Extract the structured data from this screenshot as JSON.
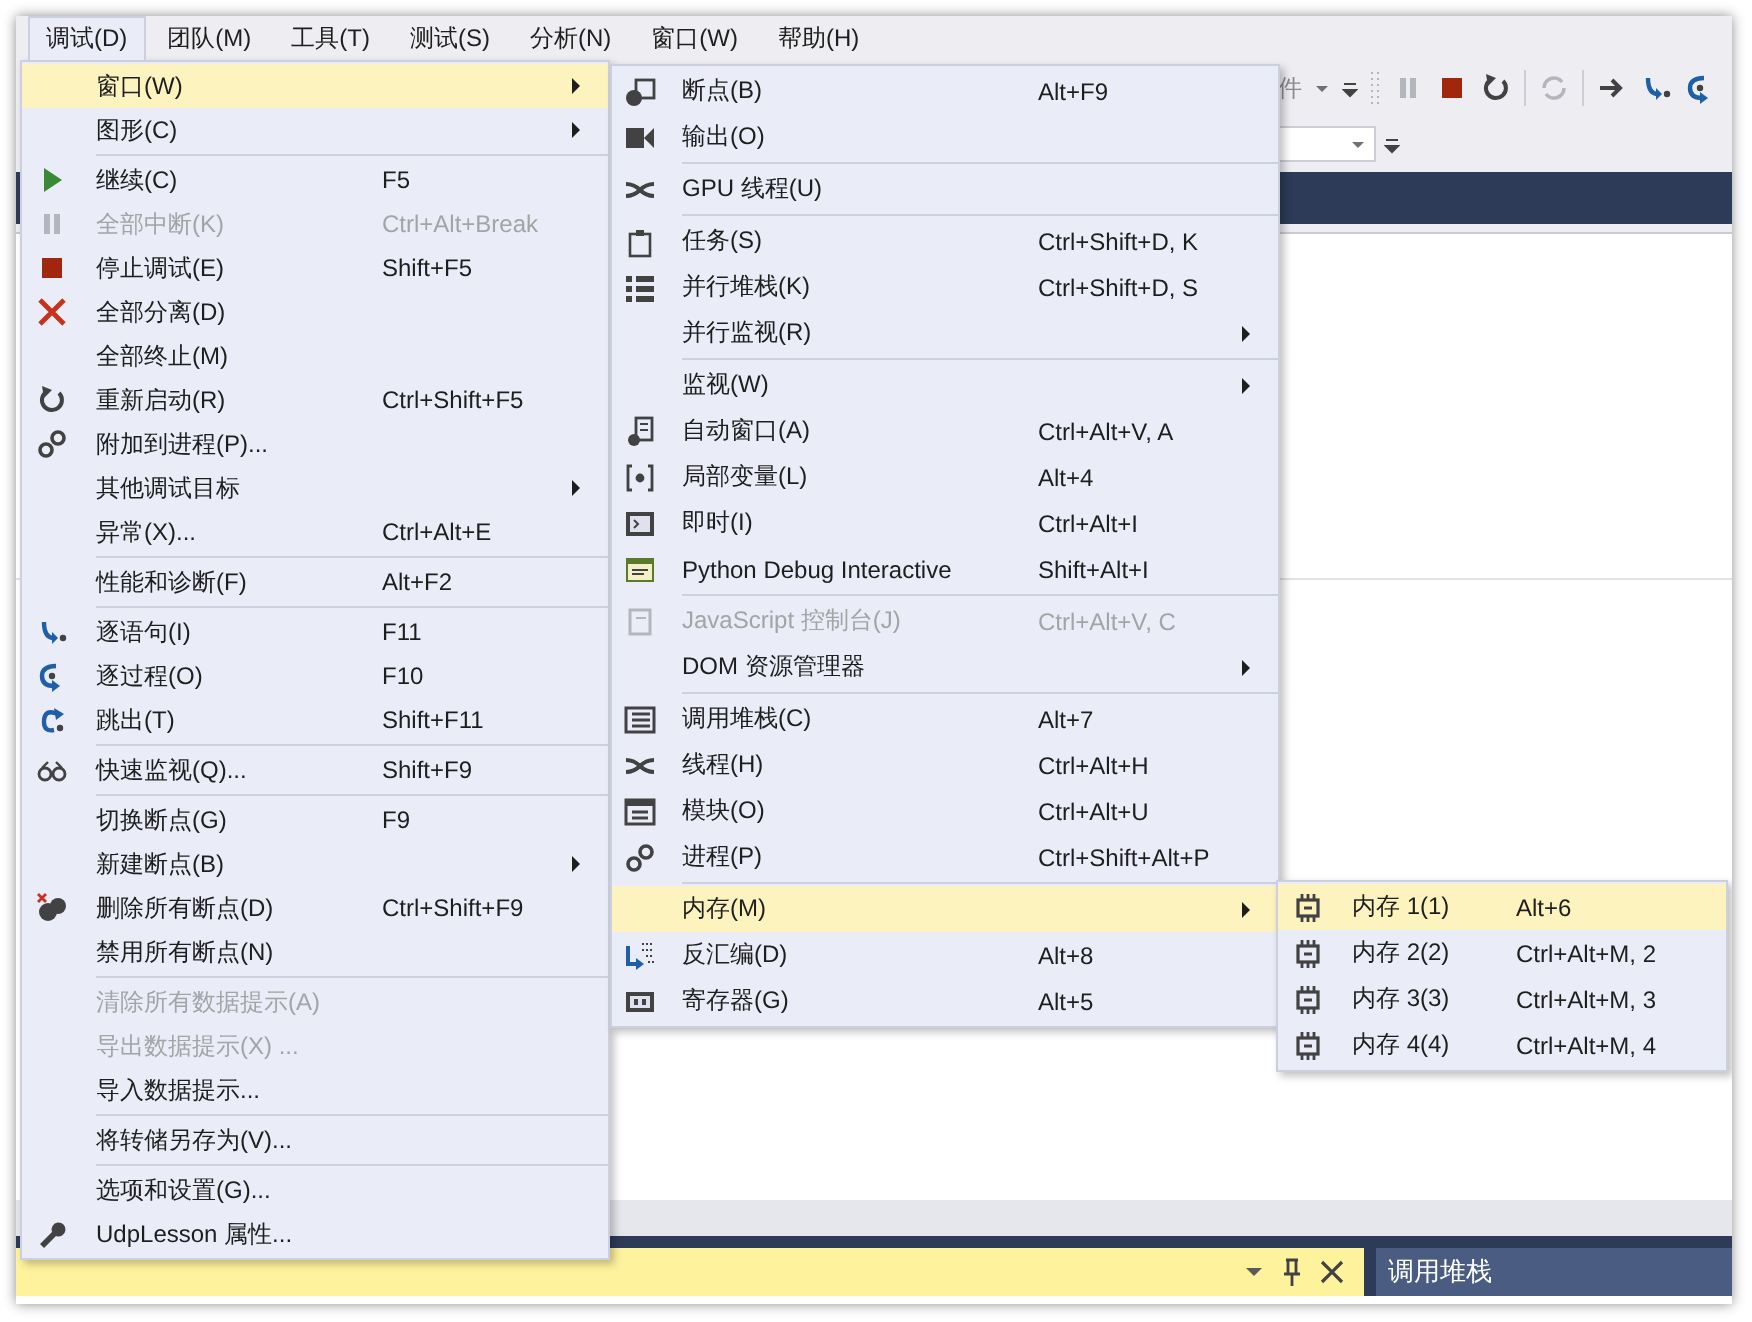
{
  "menubar": [
    {
      "label": "调试(D)",
      "selected": true
    },
    {
      "label": "团队(M)",
      "selected": false
    },
    {
      "label": "工具(T)",
      "selected": false
    },
    {
      "label": "测试(S)",
      "selected": false
    },
    {
      "label": "分析(N)",
      "selected": false
    },
    {
      "label": "窗口(W)",
      "selected": false
    },
    {
      "label": "帮助(H)",
      "selected": false
    }
  ],
  "toolbar": {
    "combo_text": "件"
  },
  "debug_menu": {
    "items": [
      {
        "kind": "item",
        "label": "窗口(W)",
        "submenu": true,
        "disabled": false,
        "selected": true
      },
      {
        "kind": "item",
        "label": "图形(C)",
        "submenu": true,
        "disabled": false,
        "selected": false
      },
      {
        "kind": "separator"
      },
      {
        "kind": "item",
        "label": "继续(C)",
        "shortcut": "F5",
        "submenu": false,
        "disabled": false,
        "selected": false
      },
      {
        "kind": "item",
        "label": "全部中断(K)",
        "shortcut": "Ctrl+Alt+Break",
        "submenu": false,
        "disabled": true,
        "selected": false
      },
      {
        "kind": "item",
        "label": "停止调试(E)",
        "shortcut": "Shift+F5",
        "submenu": false,
        "disabled": false,
        "selected": false
      },
      {
        "kind": "item",
        "label": "全部分离(D)",
        "submenu": false,
        "disabled": false,
        "selected": false
      },
      {
        "kind": "item",
        "label": "全部终止(M)",
        "submenu": false,
        "disabled": false,
        "selected": false
      },
      {
        "kind": "item",
        "label": "重新启动(R)",
        "shortcut": "Ctrl+Shift+F5",
        "submenu": false,
        "disabled": false,
        "selected": false
      },
      {
        "kind": "item",
        "label": "附加到进程(P)...",
        "submenu": false,
        "disabled": false,
        "selected": false
      },
      {
        "kind": "item",
        "label": "其他调试目标",
        "submenu": true,
        "disabled": false,
        "selected": false
      },
      {
        "kind": "item",
        "label": "异常(X)...",
        "shortcut": "Ctrl+Alt+E",
        "submenu": false,
        "disabled": false,
        "selected": false
      },
      {
        "kind": "separator"
      },
      {
        "kind": "item",
        "label": "性能和诊断(F)",
        "shortcut": "Alt+F2",
        "submenu": false,
        "disabled": false,
        "selected": false
      },
      {
        "kind": "separator"
      },
      {
        "kind": "item",
        "label": "逐语句(I)",
        "shortcut": "F11",
        "submenu": false,
        "disabled": false,
        "selected": false
      },
      {
        "kind": "item",
        "label": "逐过程(O)",
        "shortcut": "F10",
        "submenu": false,
        "disabled": false,
        "selected": false
      },
      {
        "kind": "item",
        "label": "跳出(T)",
        "shortcut": "Shift+F11",
        "submenu": false,
        "disabled": false,
        "selected": false
      },
      {
        "kind": "separator"
      },
      {
        "kind": "item",
        "label": "快速监视(Q)...",
        "shortcut": "Shift+F9",
        "submenu": false,
        "disabled": false,
        "selected": false
      },
      {
        "kind": "separator"
      },
      {
        "kind": "item",
        "label": "切换断点(G)",
        "shortcut": "F9",
        "submenu": false,
        "disabled": false,
        "selected": false
      },
      {
        "kind": "item",
        "label": "新建断点(B)",
        "submenu": true,
        "disabled": false,
        "selected": false
      },
      {
        "kind": "item",
        "label": "删除所有断点(D)",
        "shortcut": "Ctrl+Shift+F9",
        "submenu": false,
        "disabled": false,
        "selected": false
      },
      {
        "kind": "item",
        "label": "禁用所有断点(N)",
        "submenu": false,
        "disabled": false,
        "selected": false
      },
      {
        "kind": "separator"
      },
      {
        "kind": "item",
        "label": "清除所有数据提示(A)",
        "submenu": false,
        "disabled": true,
        "selected": false
      },
      {
        "kind": "item",
        "label": "导出数据提示(X) ...",
        "submenu": false,
        "disabled": true,
        "selected": false
      },
      {
        "kind": "item",
        "label": "导入数据提示...",
        "submenu": false,
        "disabled": false,
        "selected": false
      },
      {
        "kind": "separator"
      },
      {
        "kind": "item",
        "label": "将转储另存为(V)...",
        "submenu": false,
        "disabled": false,
        "selected": false
      },
      {
        "kind": "separator"
      },
      {
        "kind": "item",
        "label": "选项和设置(G)...",
        "submenu": false,
        "disabled": false,
        "selected": false
      },
      {
        "kind": "item",
        "label": "UdpLesson 属性...",
        "submenu": false,
        "disabled": false,
        "selected": false
      }
    ]
  },
  "window_submenu": {
    "items": [
      {
        "kind": "item",
        "label": "断点(B)",
        "shortcut": "Alt+F9",
        "submenu": false,
        "disabled": false,
        "selected": false
      },
      {
        "kind": "item",
        "label": "输出(O)",
        "submenu": false,
        "disabled": false,
        "selected": false
      },
      {
        "kind": "separator"
      },
      {
        "kind": "item",
        "label": "GPU 线程(U)",
        "submenu": false,
        "disabled": false,
        "selected": false
      },
      {
        "kind": "separator"
      },
      {
        "kind": "item",
        "label": "任务(S)",
        "shortcut": "Ctrl+Shift+D, K",
        "submenu": false,
        "disabled": false,
        "selected": false
      },
      {
        "kind": "item",
        "label": "并行堆栈(K)",
        "shortcut": "Ctrl+Shift+D, S",
        "submenu": false,
        "disabled": false,
        "selected": false
      },
      {
        "kind": "item",
        "label": "并行监视(R)",
        "submenu": true,
        "disabled": false,
        "selected": false
      },
      {
        "kind": "separator"
      },
      {
        "kind": "item",
        "label": "监视(W)",
        "submenu": true,
        "disabled": false,
        "selected": false
      },
      {
        "kind": "item",
        "label": "自动窗口(A)",
        "shortcut": "Ctrl+Alt+V, A",
        "submenu": false,
        "disabled": false,
        "selected": false
      },
      {
        "kind": "item",
        "label": "局部变量(L)",
        "shortcut": "Alt+4",
        "submenu": false,
        "disabled": false,
        "selected": false
      },
      {
        "kind": "item",
        "label": "即时(I)",
        "shortcut": "Ctrl+Alt+I",
        "submenu": false,
        "disabled": false,
        "selected": false
      },
      {
        "kind": "item",
        "label": "Python Debug Interactive",
        "shortcut": "Shift+Alt+I",
        "submenu": false,
        "disabled": false,
        "selected": false
      },
      {
        "kind": "separator"
      },
      {
        "kind": "item",
        "label": "JavaScript 控制台(J)",
        "shortcut": "Ctrl+Alt+V, C",
        "submenu": false,
        "disabled": true,
        "selected": false
      },
      {
        "kind": "item",
        "label": "DOM 资源管理器",
        "submenu": true,
        "disabled": false,
        "selected": false
      },
      {
        "kind": "separator"
      },
      {
        "kind": "item",
        "label": "调用堆栈(C)",
        "shortcut": "Alt+7",
        "submenu": false,
        "disabled": false,
        "selected": false
      },
      {
        "kind": "item",
        "label": "线程(H)",
        "shortcut": "Ctrl+Alt+H",
        "submenu": false,
        "disabled": false,
        "selected": false
      },
      {
        "kind": "item",
        "label": "模块(O)",
        "shortcut": "Ctrl+Alt+U",
        "submenu": false,
        "disabled": false,
        "selected": false
      },
      {
        "kind": "item",
        "label": "进程(P)",
        "shortcut": "Ctrl+Shift+Alt+P",
        "submenu": false,
        "disabled": false,
        "selected": false
      },
      {
        "kind": "separator"
      },
      {
        "kind": "item",
        "label": "内存(M)",
        "submenu": true,
        "disabled": false,
        "selected": true
      },
      {
        "kind": "item",
        "label": "反汇编(D)",
        "shortcut": "Alt+8",
        "submenu": false,
        "disabled": false,
        "selected": false
      },
      {
        "kind": "item",
        "label": "寄存器(G)",
        "shortcut": "Alt+5",
        "submenu": false,
        "disabled": false,
        "selected": false
      }
    ]
  },
  "memory_submenu": {
    "items": [
      {
        "kind": "item",
        "label": "内存 1(1)",
        "shortcut": "Alt+6",
        "submenu": false,
        "disabled": false,
        "selected": true
      },
      {
        "kind": "item",
        "label": "内存 2(2)",
        "shortcut": "Ctrl+Alt+M, 2",
        "submenu": false,
        "disabled": false,
        "selected": false
      },
      {
        "kind": "item",
        "label": "内存 3(3)",
        "shortcut": "Ctrl+Alt+M, 3",
        "submenu": false,
        "disabled": false,
        "selected": false
      },
      {
        "kind": "item",
        "label": "内存 4(4)",
        "shortcut": "Ctrl+Alt+M, 4",
        "submenu": false,
        "disabled": false,
        "selected": false
      }
    ]
  },
  "call_stack_panel": {
    "title": "调用堆栈"
  }
}
